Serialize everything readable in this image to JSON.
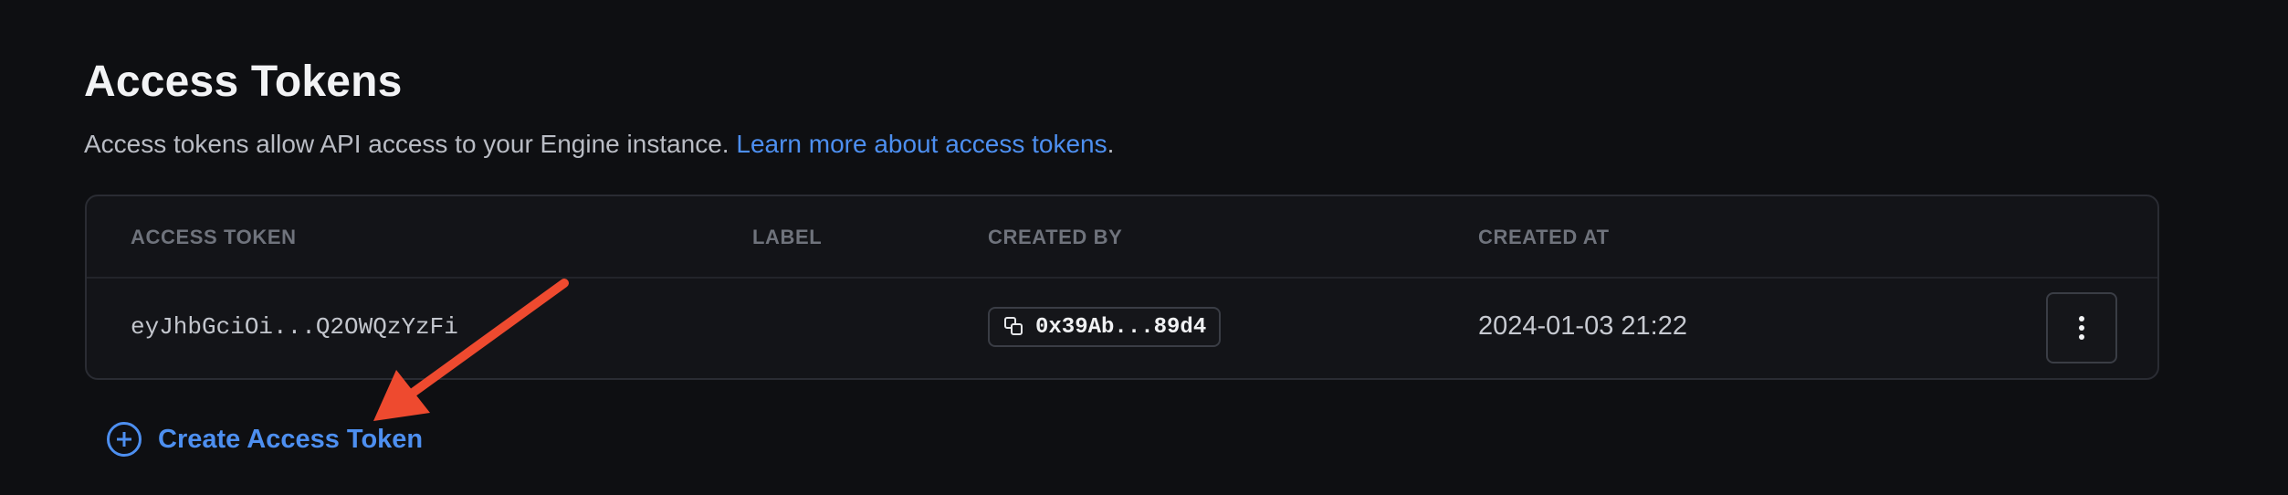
{
  "page": {
    "title": "Access Tokens",
    "description": "Access tokens allow API access to your Engine instance. ",
    "learn_more_link": "Learn more about access tokens",
    "description_end": "."
  },
  "table": {
    "headers": {
      "access_token": "ACCESS TOKEN",
      "label": "LABEL",
      "created_by": "CREATED BY",
      "created_at": "CREATED AT"
    },
    "rows": [
      {
        "access_token": "eyJhbGciOi...Q2OWQzYzFi",
        "label": "",
        "created_by": "0x39Ab...89d4",
        "created_at": "2024-01-03 21:22"
      }
    ]
  },
  "actions": {
    "create_label": "Create Access Token"
  },
  "icons": {
    "copy": "copy-icon",
    "menu": "more-vertical-icon",
    "create": "plus-circle-icon",
    "annotation": "red-arrow-icon"
  },
  "colors": {
    "accent": "#4d8ff0",
    "annotation_arrow": "#ee4a2f",
    "background": "#0e0f12"
  }
}
